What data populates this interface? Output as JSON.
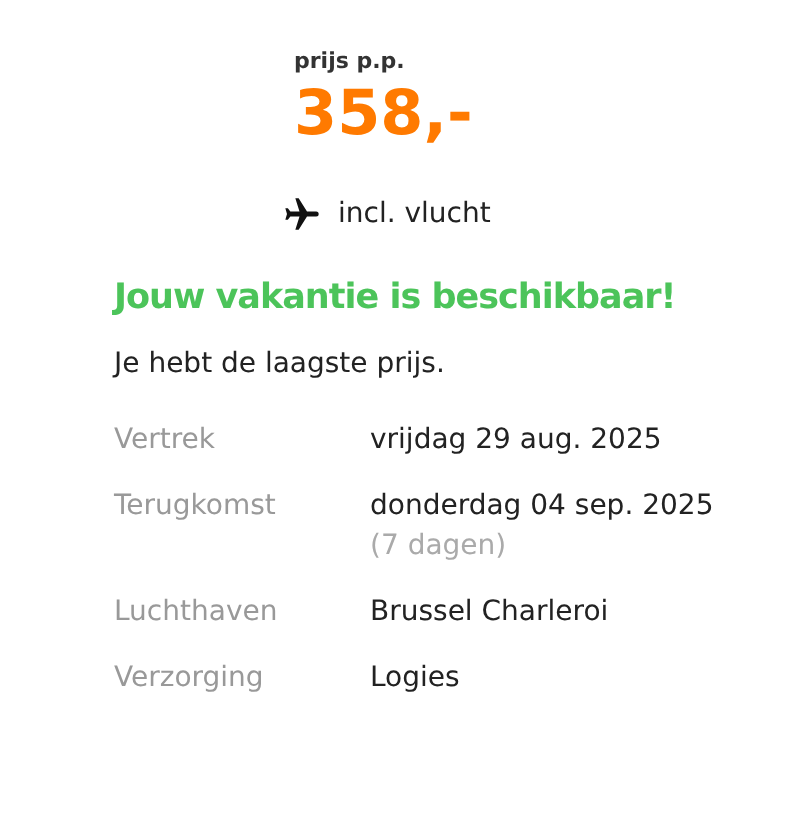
{
  "price": {
    "label": "prijs p.p.",
    "amount": "358,-"
  },
  "included": "incl. vlucht",
  "heading": "Jouw vakantie is beschikbaar!",
  "message": "Je hebt de laagste prijs.",
  "details": [
    {
      "label": "Vertrek",
      "value": "vrijdag 29 aug. 2025"
    },
    {
      "label": "Terugkomst",
      "value": "donderdag 04 sep. 2025",
      "note": "(7 dagen)"
    },
    {
      "label": "Luchthaven",
      "value": "Brussel Charleroi"
    },
    {
      "label": "Verzorging",
      "value": "Logies"
    }
  ]
}
